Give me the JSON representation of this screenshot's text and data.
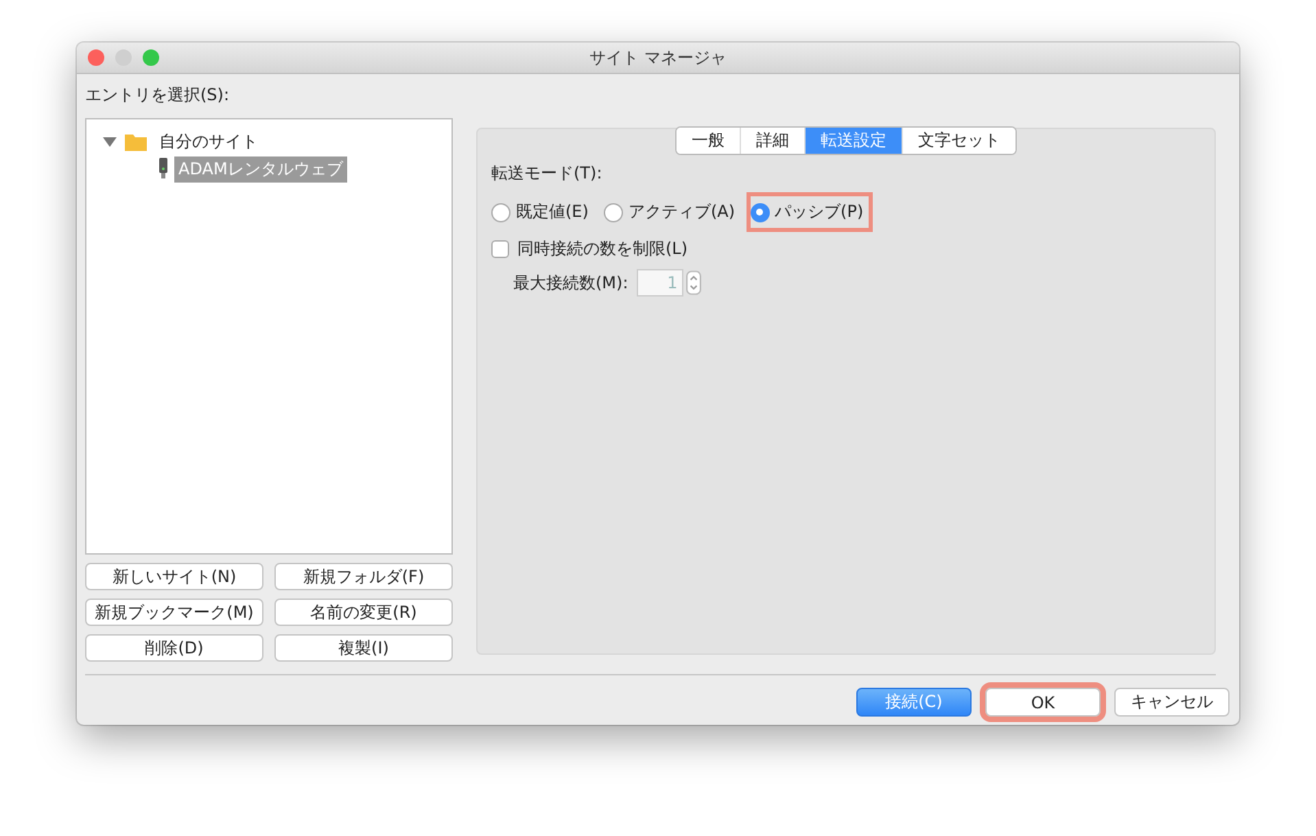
{
  "window": {
    "title": "サイト マネージャ"
  },
  "entry_label": "エントリを選択(S):",
  "tree": [
    {
      "label": "自分のサイト",
      "kind": "folder",
      "expanded": true,
      "selected": false,
      "children": [
        {
          "label": "ADAMレンタルウェブ",
          "kind": "server",
          "selected": true
        }
      ]
    }
  ],
  "site_buttons": [
    "新しいサイト(N)",
    "新規フォルダ(F)",
    "新規ブックマーク(M)",
    "名前の変更(R)",
    "削除(D)",
    "複製(I)"
  ],
  "tabs": [
    {
      "label": "一般",
      "selected": false
    },
    {
      "label": "詳細",
      "selected": false
    },
    {
      "label": "転送設定",
      "selected": true
    },
    {
      "label": "文字セット",
      "selected": false
    }
  ],
  "transfer_mode": {
    "label": "転送モード(T):",
    "options": [
      {
        "label": "既定値(E)",
        "selected": false,
        "highlighted": false
      },
      {
        "label": "アクティブ(A)",
        "selected": false,
        "highlighted": false
      },
      {
        "label": "パッシブ(P)",
        "selected": true,
        "highlighted": true
      }
    ]
  },
  "limit": {
    "label": "同時接続の数を制限(L)",
    "checked": false
  },
  "max_connections": {
    "label": "最大接続数(M):",
    "value": "1",
    "disabled": true
  },
  "dialog_buttons": [
    {
      "label": "接続(C)",
      "kind": "primary",
      "highlighted": false
    },
    {
      "label": "OK",
      "kind": "default",
      "highlighted": true
    },
    {
      "label": "キャンセル",
      "kind": "default",
      "highlighted": false
    }
  ]
}
